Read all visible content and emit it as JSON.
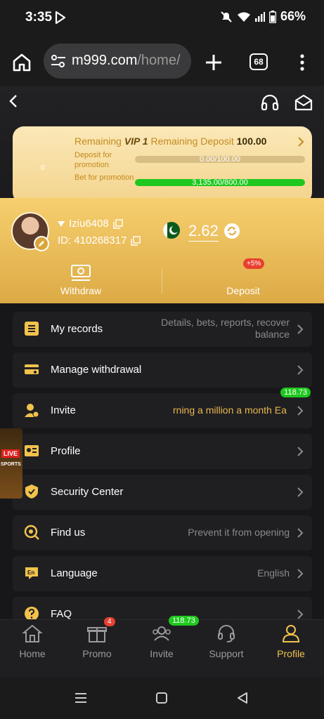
{
  "status": {
    "time": "3:35",
    "battery": "66%"
  },
  "browser": {
    "url_main": "m999.com",
    "url_rest": "/home/",
    "tab_count": "68"
  },
  "vip": {
    "prefix": "Remaining ",
    "level": "VIP 1",
    "mid": " Remaining Deposit ",
    "amount": "100.00",
    "badge": "0",
    "deposit_label": "Deposit for promotion",
    "deposit_text": "0.00/100.00",
    "deposit_progress": 0,
    "bet_label": "Bet for promotion",
    "bet_text": "3,135.00/800.00",
    "bet_progress": 1
  },
  "user": {
    "name": "Iziu6408",
    "id": "ID: 410268317",
    "balance": "2.62"
  },
  "actions": {
    "withdraw": "Withdraw",
    "deposit": "Deposit",
    "deposit_tag": "+5%"
  },
  "menu": [
    {
      "label": "My records",
      "value": "Details, bets, reports, recover balance"
    },
    {
      "label": "Manage withdrawal",
      "value": ""
    },
    {
      "label": "Invite",
      "value": "rning a million a month  Ea",
      "badge": "118.73"
    },
    {
      "label": "Profile",
      "value": ""
    },
    {
      "label": "Security Center",
      "value": ""
    },
    {
      "label": "Find us",
      "value": "Prevent it from opening"
    },
    {
      "label": "Language",
      "value": "English"
    },
    {
      "label": "FAQ",
      "value": ""
    }
  ],
  "live": {
    "live": "LIVE",
    "sports": "SPORTS"
  },
  "nav": [
    {
      "label": "Home"
    },
    {
      "label": "Promo",
      "badge": "4"
    },
    {
      "label": "Invite",
      "badge": "118.73"
    },
    {
      "label": "Support"
    },
    {
      "label": "Profile"
    }
  ],
  "colors": {
    "accent": "#f2c24c",
    "green": "#1ec81e",
    "red": "#e8402f"
  }
}
